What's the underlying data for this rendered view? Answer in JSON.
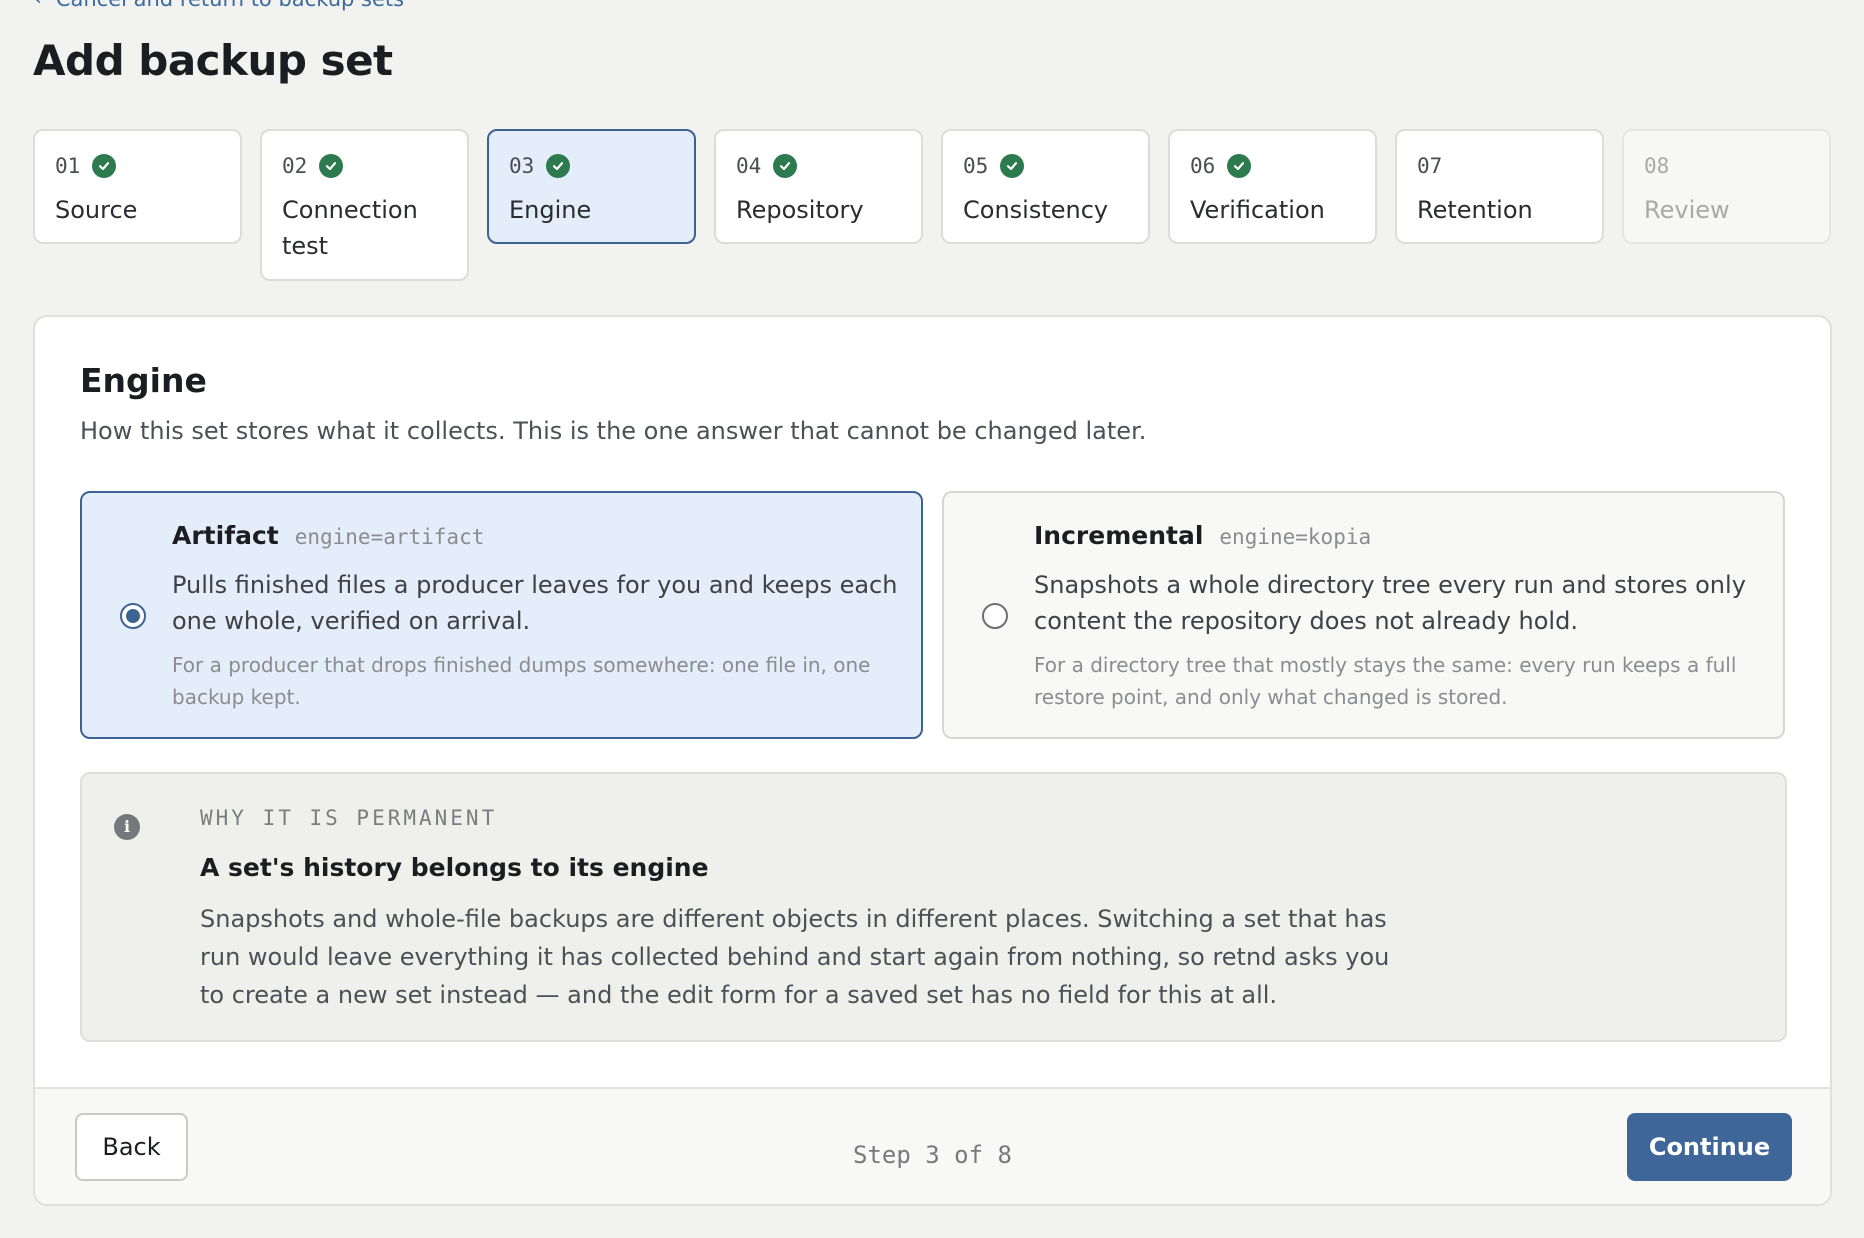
{
  "nav": {
    "back_label": "Cancel and return to backup sets"
  },
  "page": {
    "title": "Add backup set"
  },
  "steps": [
    {
      "number": "01",
      "label": "Source",
      "status": "complete"
    },
    {
      "number": "02",
      "label": "Connection test",
      "status": "complete"
    },
    {
      "number": "03",
      "label": "Engine",
      "status": "current"
    },
    {
      "number": "04",
      "label": "Repository",
      "status": "complete"
    },
    {
      "number": "05",
      "label": "Consistency",
      "status": "complete"
    },
    {
      "number": "06",
      "label": "Verification",
      "status": "complete"
    },
    {
      "number": "07",
      "label": "Retention",
      "status": "available"
    },
    {
      "number": "08",
      "label": "Review",
      "status": "upcoming"
    }
  ],
  "engine": {
    "title": "Engine",
    "description": "How this set stores what it collects. This is the one answer that cannot be changed later.",
    "options": [
      {
        "name": "Artifact",
        "code": "engine=artifact",
        "description": "Pulls finished files a producer leaves for you and keeps each one whole, verified on arrival.",
        "note": "For a producer that drops finished dumps somewhere: one file in, one backup kept.",
        "selected": true
      },
      {
        "name": "Incremental",
        "code": "engine=kopia",
        "description": "Snapshots a whole directory tree every run and stores only content the repository does not already hold.",
        "note": "For a directory tree that mostly stays the same: every run keeps a full restore point, and only what changed is stored.",
        "selected": false
      }
    ],
    "info": {
      "eyebrow": "WHY IT IS PERMANENT",
      "title": "A set's history belongs to its engine",
      "body": "Snapshots and whole-file backups are different objects in different places. Switching a set that has run would leave everything it has collected behind and start again from nothing, so retnd asks you to create a new set instead — and the edit form for a saved set has no field for this at all."
    }
  },
  "footer": {
    "back_label": "Back",
    "step_counter": "Step 3 of 8",
    "continue_label": "Continue"
  },
  "colors": {
    "accent": "#3e6699",
    "selected_bg": "#e4eefa",
    "complete": "#2c7a4e",
    "page_bg": "#f2f2f0"
  },
  "icons": {
    "back": "chevron-left-icon",
    "complete": "check-circle-icon",
    "info": "info-icon"
  }
}
